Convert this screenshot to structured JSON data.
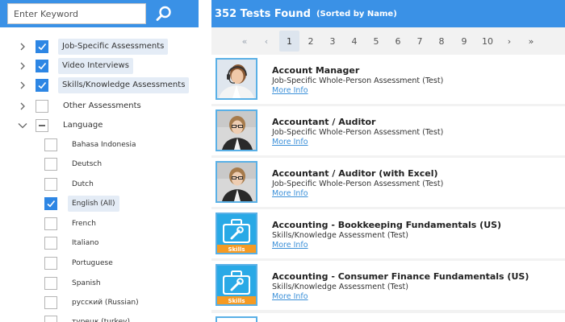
{
  "search": {
    "placeholder": "Enter Keyword",
    "icon": "search-icon"
  },
  "filters": {
    "categories": [
      {
        "label": "Job-Specific Assessments",
        "checked": true,
        "expand": "chevron-right-icon"
      },
      {
        "label": "Video Interviews",
        "checked": true,
        "expand": "chevron-right-icon"
      },
      {
        "label": "Skills/Knowledge Assessments",
        "checked": true,
        "expand": "chevron-right-icon"
      },
      {
        "label": "Other Assessments",
        "checked": false,
        "expand": "chevron-right-icon"
      },
      {
        "label": "Language",
        "checked": "partial",
        "expand": "chevron-down-icon"
      }
    ],
    "languages": [
      {
        "label": "Bahasa Indonesia",
        "checked": false
      },
      {
        "label": "Deutsch",
        "checked": false
      },
      {
        "label": "Dutch",
        "checked": false
      },
      {
        "label": "English (All)",
        "checked": true
      },
      {
        "label": "French",
        "checked": false
      },
      {
        "label": "Italiano",
        "checked": false
      },
      {
        "label": "Portuguese",
        "checked": false
      },
      {
        "label": "Spanish",
        "checked": false
      },
      {
        "label": "русский (Russian)",
        "checked": false
      },
      {
        "label": "турецк (turkey)",
        "checked": false
      }
    ]
  },
  "results": {
    "count_label": "352 Tests Found",
    "sort_label": "(Sorted by Name)"
  },
  "pagination": {
    "first": "«",
    "prev": "‹",
    "pages": [
      "1",
      "2",
      "3",
      "4",
      "5",
      "6",
      "7",
      "8",
      "9",
      "10"
    ],
    "current": "1",
    "next": "›",
    "last": "»"
  },
  "tests": [
    {
      "title": "Account Manager",
      "type": "Job-Specific Whole-Person Assessment (Test)",
      "link": "More Info",
      "thumbnail": "headset-person-photo"
    },
    {
      "title": "Accountant / Auditor",
      "type": "Job-Specific Whole-Person Assessment (Test)",
      "link": "More Info",
      "thumbnail": "accountant-person-photo"
    },
    {
      "title": "Accountant / Auditor (with Excel)",
      "type": "Job-Specific Whole-Person Assessment (Test)",
      "link": "More Info",
      "thumbnail": "accountant-person-photo"
    },
    {
      "title": "Accounting - Bookkeeping Fundamentals (US)",
      "type": "Skills/Knowledge Assessment (Test)",
      "link": "More Info",
      "thumbnail": "skills-toolbox-icon",
      "badge": "Skills"
    },
    {
      "title": "Accounting - Consumer Finance Fundamentals (US)",
      "type": "Skills/Knowledge Assessment (Test)",
      "link": "More Info",
      "thumbnail": "skills-toolbox-icon",
      "badge": "Skills"
    }
  ],
  "colors": {
    "header_blue": "#3a91e6",
    "checkbox_blue": "#2d86e4",
    "link_blue": "#3a8fd8",
    "thumb_border": "#5ab0e6",
    "skills_orange": "#f59a23"
  }
}
